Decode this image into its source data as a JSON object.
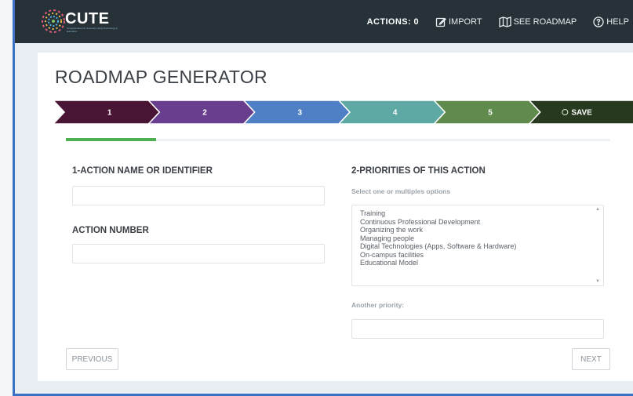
{
  "app": {
    "brand": "CUTE",
    "brand_tagline": "Competencies for University Using Technology in Education"
  },
  "nav": {
    "actions_label": "ACTIONS: 0",
    "import_label": "IMPORT",
    "roadmap_label": "SEE ROADMAP",
    "help_label": "HELP"
  },
  "page": {
    "title": "ROADMAP GENERATOR"
  },
  "steps": [
    {
      "label": "1",
      "color": "#4a1535"
    },
    {
      "label": "2",
      "color": "#6a3e8e"
    },
    {
      "label": "3",
      "color": "#4f7fc4"
    },
    {
      "label": "4",
      "color": "#5fa9a5"
    },
    {
      "label": "5",
      "color": "#5f8b4c"
    },
    {
      "label": "SAVE",
      "color": "#273a1f"
    }
  ],
  "progress": {
    "fraction": 0.166
  },
  "form": {
    "action_name_label": "1-ACTION NAME OR IDENTIFIER",
    "action_name_value": "",
    "action_number_label": "ACTION NUMBER",
    "action_number_value": "",
    "priorities_label": "2-PRIORITIES OF THIS ACTION",
    "priorities_hint": "Select one or multiples options",
    "priorities_options": [
      "Training",
      "Continuous Professional Development",
      "Organizing the work",
      "Managing people",
      "Digital Technologies (Apps, Software & Hardware)",
      "On-campus facilities",
      "Educational Model"
    ],
    "another_priority_label": "Another priority:",
    "another_priority_value": ""
  },
  "buttons": {
    "previous": "PREVIOUS",
    "next": "NEXT"
  }
}
